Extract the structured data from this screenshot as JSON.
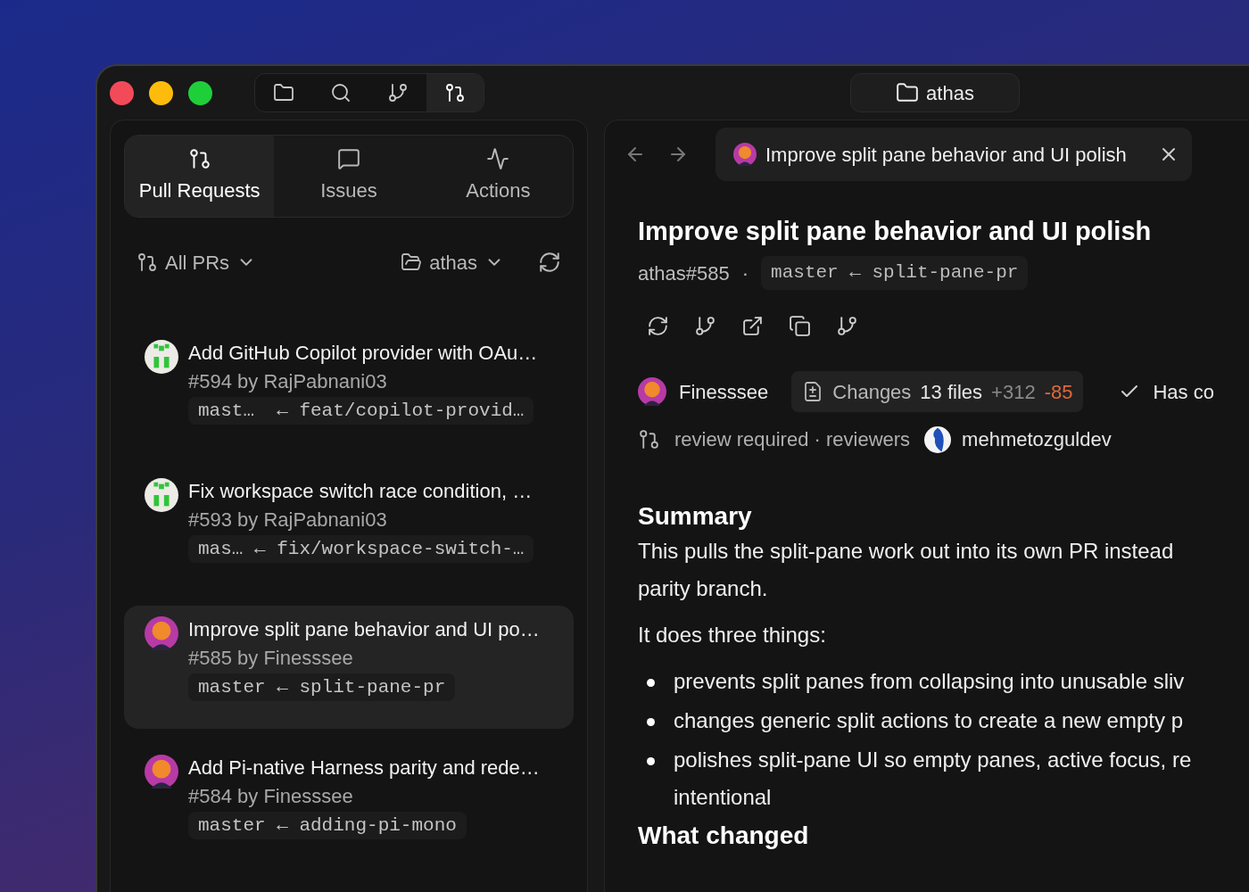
{
  "toolbar": {
    "buttons": [
      {
        "kind": "folder",
        "selected": false
      },
      {
        "kind": "search",
        "selected": false
      },
      {
        "kind": "branch",
        "selected": false
      },
      {
        "kind": "pull-request",
        "selected": true
      }
    ],
    "workspace": "athas"
  },
  "sidebar": {
    "tabs": [
      {
        "label": "Pull Requests",
        "kind": "pull-request",
        "selected": true
      },
      {
        "label": "Issues",
        "kind": "message",
        "selected": false
      },
      {
        "label": "Actions",
        "kind": "activity",
        "selected": false
      }
    ],
    "filter": "All PRs",
    "repo": "athas",
    "pull_requests": [
      {
        "title": "Add GitHub Copilot provider with OAu…",
        "meta": "#594 by RajPabnani03",
        "branches": "mast…  ← feat/copilot-provid…",
        "kind": "identicon",
        "selected": false
      },
      {
        "title": "Fix workspace switch race condition, …",
        "meta": "#593 by RajPabnani03",
        "branches": "mas… ← fix/workspace-switch-…",
        "kind": "identicon",
        "selected": false
      },
      {
        "title": "Improve split pane behavior and UI po…",
        "meta": "#585 by Finesssee",
        "branches": "master ← split-pane-pr",
        "kind": "cartoon",
        "selected": true
      },
      {
        "title": "Add Pi-native Harness parity and rede…",
        "meta": "#584 by Finesssee",
        "branches": "master ← adding-pi-mono",
        "kind": "cartoon",
        "selected": false
      }
    ]
  },
  "detail": {
    "tab_title": "Improve split pane behavior and UI polish",
    "title": "Improve split pane behavior and UI polish",
    "ref": "athas#585",
    "separator": "·",
    "branches": "master ← split-pane-pr",
    "author": "Finesssee",
    "changes": {
      "label": "Changes",
      "files": "13 files",
      "additions": "+312",
      "deletions": "-85"
    },
    "check": "Has co",
    "review": "review required · reviewers",
    "reviewer": "mehmetozguldev",
    "body": [
      {
        "kind": "heading",
        "text": "Summary"
      },
      {
        "kind": "paragraph",
        "text": "This pulls the split-pane work out into its own PR instead\nparity branch."
      },
      {
        "kind": "paragraph",
        "text": "It does three things:"
      },
      {
        "kind": "bullet",
        "text": "prevents split panes from collapsing into unusable sliv"
      },
      {
        "kind": "bullet",
        "text": "changes generic split actions to create a new empty p"
      },
      {
        "kind": "bullet",
        "text": "polishes split-pane UI so empty panes, active focus, re\nintentional"
      },
      {
        "kind": "heading",
        "text": "What changed"
      }
    ]
  }
}
